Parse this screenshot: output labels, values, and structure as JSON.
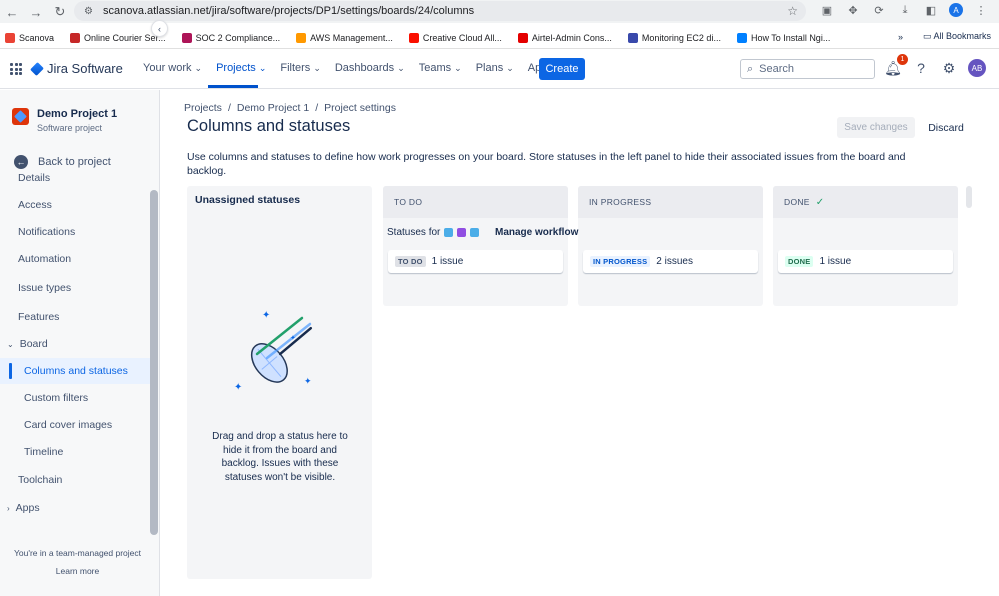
{
  "browser": {
    "url": "scanova.atlassian.net/jira/software/projects/DP1/settings/boards/24/columns",
    "profile_initial": "A",
    "bookmarks": [
      {
        "label": "Scanova",
        "color": "#ea4335"
      },
      {
        "label": "Online Courier Ser...",
        "color": "#c62828"
      },
      {
        "label": "SOC 2 Compliance...",
        "color": "#ad1457"
      },
      {
        "label": "AWS Management...",
        "color": "#ff9900"
      },
      {
        "label": "Creative Cloud All...",
        "color": "#fa0f00"
      },
      {
        "label": "Airtel-Admin Cons...",
        "color": "#e40000"
      },
      {
        "label": "Monitoring EC2 di...",
        "color": "#3949ab"
      },
      {
        "label": "How To Install Ngi...",
        "color": "#0080ff"
      }
    ],
    "more_bookmarks": "»",
    "all_bookmarks": "All Bookmarks"
  },
  "jira_nav": {
    "product": "Jira Software",
    "menu": [
      {
        "label": "Your work",
        "active": false
      },
      {
        "label": "Projects",
        "active": true
      },
      {
        "label": "Filters",
        "active": false
      },
      {
        "label": "Dashboards",
        "active": false
      },
      {
        "label": "Teams",
        "active": false
      },
      {
        "label": "Plans",
        "active": false
      },
      {
        "label": "Apps",
        "active": false
      }
    ],
    "create_label": "Create",
    "search_placeholder": "Search",
    "notification_count": "1",
    "avatar_initials": "AB"
  },
  "sidebar": {
    "project_name": "Demo Project 1",
    "project_type": "Software project",
    "back_label": "Back to project",
    "items": [
      {
        "label": "Details",
        "level": 0,
        "active": false,
        "caret": ""
      },
      {
        "label": "Access",
        "level": 0,
        "active": false,
        "caret": ""
      },
      {
        "label": "Notifications",
        "level": 0,
        "active": false,
        "caret": ""
      },
      {
        "label": "Automation",
        "level": 0,
        "active": false,
        "caret": ""
      },
      {
        "label": "Issue types",
        "level": 0,
        "active": false,
        "caret": ""
      },
      {
        "label": "Features",
        "level": 0,
        "active": false,
        "caret": ""
      },
      {
        "label": "Board",
        "level": 0,
        "active": false,
        "caret": "down"
      },
      {
        "label": "Columns and statuses",
        "level": 1,
        "active": true,
        "caret": ""
      },
      {
        "label": "Custom filters",
        "level": 1,
        "active": false,
        "caret": ""
      },
      {
        "label": "Card cover images",
        "level": 1,
        "active": false,
        "caret": ""
      },
      {
        "label": "Timeline",
        "level": 1,
        "active": false,
        "caret": ""
      },
      {
        "label": "Toolchain",
        "level": 0,
        "active": false,
        "caret": ""
      },
      {
        "label": "Apps",
        "level": 0,
        "active": false,
        "caret": "right"
      }
    ],
    "team_note": "You're in a team-managed project",
    "learn_more": "Learn more"
  },
  "main": {
    "breadcrumb": [
      "Projects",
      "Demo Project 1",
      "Project settings"
    ],
    "breadcrumb_sep": "/",
    "title": "Columns and statuses",
    "save_label": "Save changes",
    "discard_label": "Discard",
    "description": "Use columns and statuses to define how work progresses on your board. Store statuses in the left panel to hide their associated issues from the board and backlog.",
    "unassigned": {
      "title": "Unassigned statuses",
      "message": "Drag and drop a status here to hide it from the board and backlog. Issues with these statuses won't be visible."
    },
    "statuses_for_label": "Statuses for",
    "manage_workflow": "Manage workflow",
    "columns": [
      {
        "name": "TO DO",
        "done_check": false,
        "status": "TO DO",
        "issues": "1 issue",
        "lozenge": "todo"
      },
      {
        "name": "IN PROGRESS",
        "done_check": false,
        "status": "IN PROGRESS",
        "issues": "2 issues",
        "lozenge": "prog"
      },
      {
        "name": "DONE",
        "done_check": true,
        "status": "DONE",
        "issues": "1 issue",
        "lozenge": "done"
      }
    ],
    "issue_type_colors": [
      "#4bade8",
      "#904ee2",
      "#4bade8"
    ]
  }
}
